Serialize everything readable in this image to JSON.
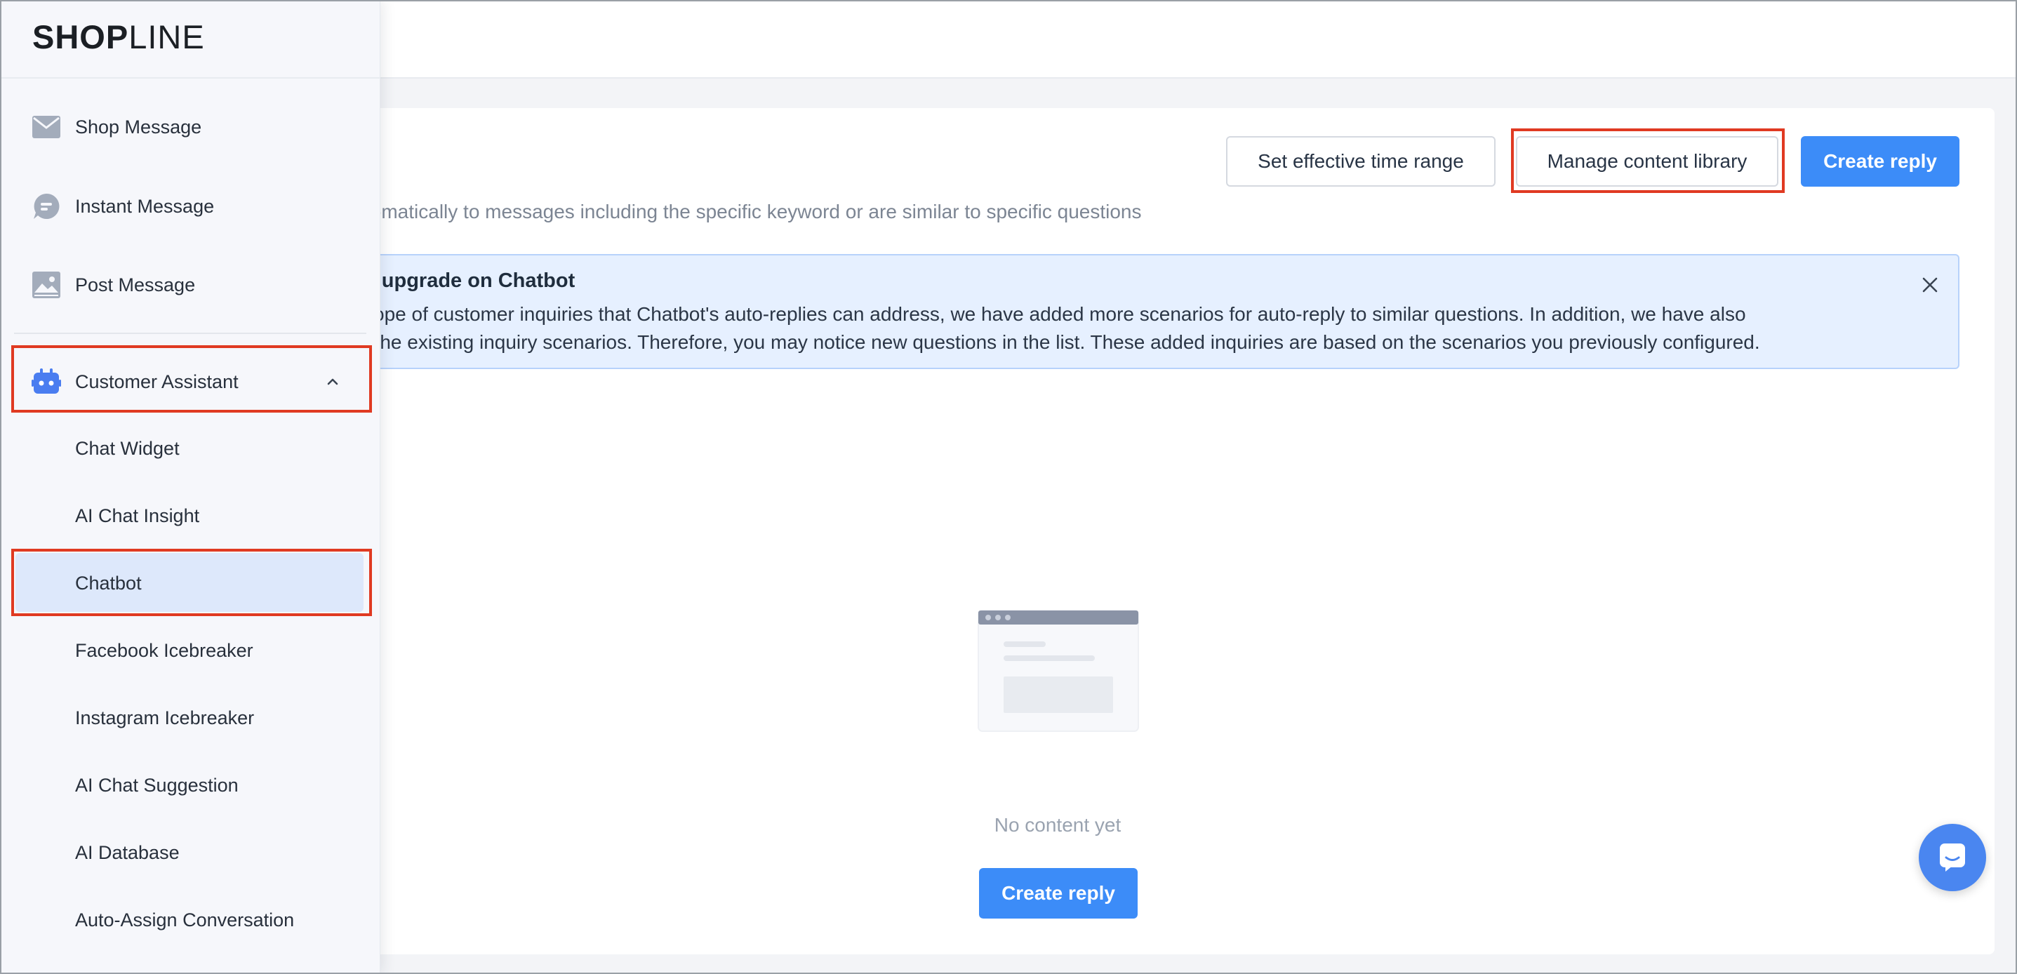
{
  "brand": {
    "logo_bold": "SHOP",
    "logo_light": "LINE"
  },
  "sidebar": {
    "items": [
      {
        "label": "Shop Message",
        "icon": "mail-icon"
      },
      {
        "label": "Instant Message",
        "icon": "chat-bubble-icon"
      },
      {
        "label": "Post Message",
        "icon": "image-icon"
      }
    ],
    "customer_assistant": {
      "label": "Customer Assistant",
      "icon": "robot-icon",
      "expanded": true,
      "children": [
        {
          "label": "Chat Widget"
        },
        {
          "label": "AI Chat Insight"
        },
        {
          "label": "Chatbot",
          "active": true
        },
        {
          "label": "Facebook Icebreaker"
        },
        {
          "label": "Instagram Icebreaker"
        },
        {
          "label": "AI Chat Suggestion"
        },
        {
          "label": "AI Database"
        },
        {
          "label": "Auto-Assign Conversation"
        }
      ]
    }
  },
  "main": {
    "subtitle": "tomatically to messages including the specific keyword or are similar to specific questions",
    "buttons": {
      "time_range": "Set effective time range",
      "content_library": "Manage content library",
      "create_reply": "Create reply"
    },
    "notice": {
      "title": "n upgrade on Chatbot",
      "line1": "cope of customer inquiries that Chatbot's auto-replies can address, we have added more scenarios for auto-reply to similar questions. In addition, we have also",
      "line2": "f the existing inquiry scenarios. Therefore, you may notice new questions in the list. These added inquiries are based on the scenarios you previously configured."
    },
    "empty_state": {
      "text": "No content yet",
      "button": "Create reply"
    }
  },
  "colors": {
    "primary": "#3c8cf8",
    "highlight": "#e03a22",
    "notice_bg": "#e6f0ff",
    "active_bg": "#dde8fb"
  }
}
